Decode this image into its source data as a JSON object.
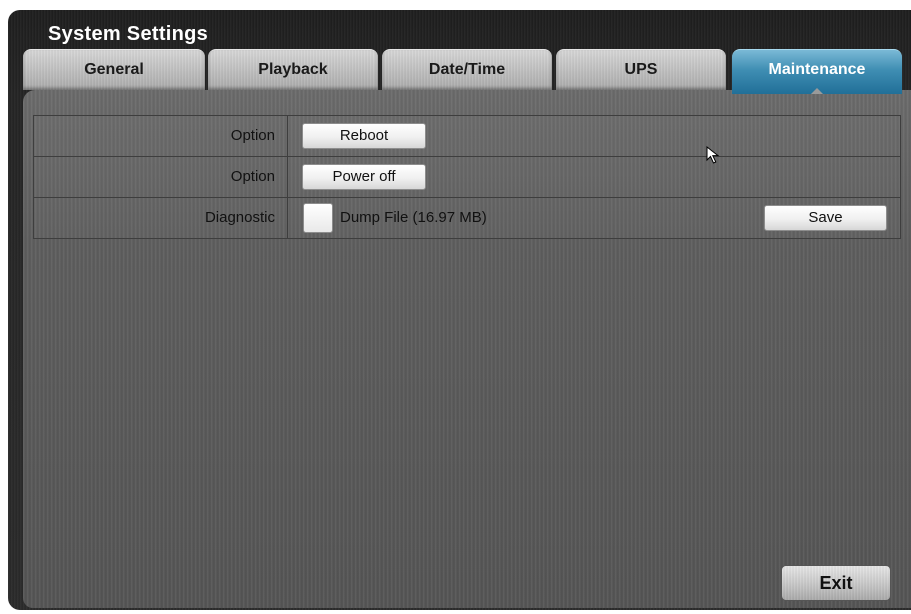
{
  "window": {
    "title": "System Settings"
  },
  "tabs": [
    {
      "label": "General",
      "active": false
    },
    {
      "label": "Playback",
      "active": false
    },
    {
      "label": "Date/Time",
      "active": false
    },
    {
      "label": "UPS",
      "active": false
    },
    {
      "label": "Maintenance",
      "active": true
    }
  ],
  "maintenance": {
    "rows": [
      {
        "label": "Option",
        "button": "Reboot"
      },
      {
        "label": "Option",
        "button": "Power off"
      },
      {
        "label": "Diagnostic",
        "checkbox_label": "Dump File (16.97 MB)",
        "checked": false,
        "button": "Save"
      }
    ]
  },
  "footer": {
    "exit_label": "Exit"
  },
  "colors": {
    "active_tab": "#2f7fa8",
    "background": "#555555"
  },
  "icons": {
    "cursor": "mouse-pointer-icon"
  }
}
